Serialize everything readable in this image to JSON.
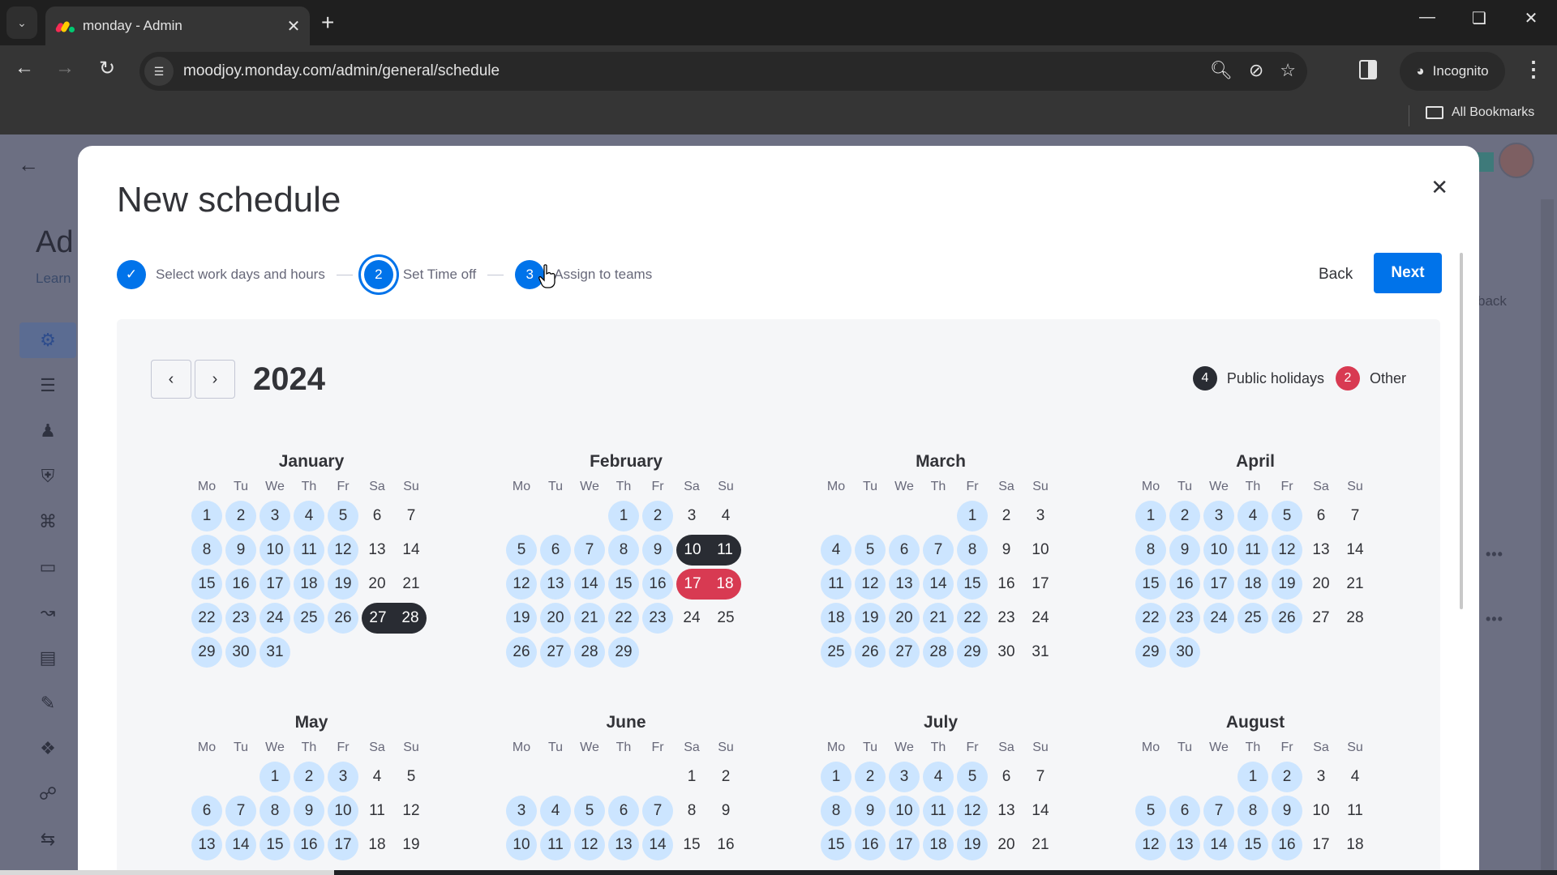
{
  "browser": {
    "tab_title": "monday - Admin",
    "url": "moodjoy.monday.com/admin/general/schedule",
    "incognito_label": "Incognito",
    "bookmarks_label": "All Bookmarks"
  },
  "background_app": {
    "title": "Ad",
    "learn_link": "Learn",
    "feedback_fragment": "back"
  },
  "modal": {
    "title": "New schedule",
    "steps": [
      {
        "number": "1",
        "label": "Select work days and hours",
        "state": "completed"
      },
      {
        "number": "2",
        "label": "Set Time off",
        "state": "current"
      },
      {
        "number": "3",
        "label": "Assign to teams",
        "state": "upcoming"
      }
    ],
    "back_label": "Back",
    "next_label": "Next"
  },
  "calendar": {
    "year": "2024",
    "legend": [
      {
        "count": "4",
        "label": "Public holidays",
        "color": "#292c33"
      },
      {
        "count": "2",
        "label": "Other",
        "color": "#d83a52"
      }
    ],
    "weekdays": [
      "Mo",
      "Tu",
      "We",
      "Th",
      "Fr",
      "Sa",
      "Su"
    ],
    "colors": {
      "workday": "#cce5ff",
      "holiday": "#292c33",
      "other": "#d83a52",
      "accent": "#0073ea"
    },
    "months": [
      {
        "name": "January",
        "offset": 0,
        "days": 31,
        "visible_weeks": 5,
        "holidays": [
          27,
          28
        ],
        "other": []
      },
      {
        "name": "February",
        "offset": 3,
        "days": 29,
        "visible_weeks": 5,
        "holidays": [
          10,
          11
        ],
        "other": [
          17,
          18
        ]
      },
      {
        "name": "March",
        "offset": 4,
        "days": 31,
        "visible_weeks": 5,
        "holidays": [],
        "other": []
      },
      {
        "name": "April",
        "offset": 0,
        "days": 30,
        "visible_weeks": 5,
        "holidays": [],
        "other": []
      },
      {
        "name": "May",
        "offset": 2,
        "days": 31,
        "visible_weeks": 3,
        "holidays": [],
        "other": []
      },
      {
        "name": "June",
        "offset": 5,
        "days": 30,
        "visible_weeks": 3,
        "holidays": [],
        "other": []
      },
      {
        "name": "July",
        "offset": 0,
        "days": 31,
        "visible_weeks": 3,
        "holidays": [],
        "other": []
      },
      {
        "name": "August",
        "offset": 3,
        "days": 31,
        "visible_weeks": 3,
        "holidays": [],
        "other": []
      }
    ]
  }
}
